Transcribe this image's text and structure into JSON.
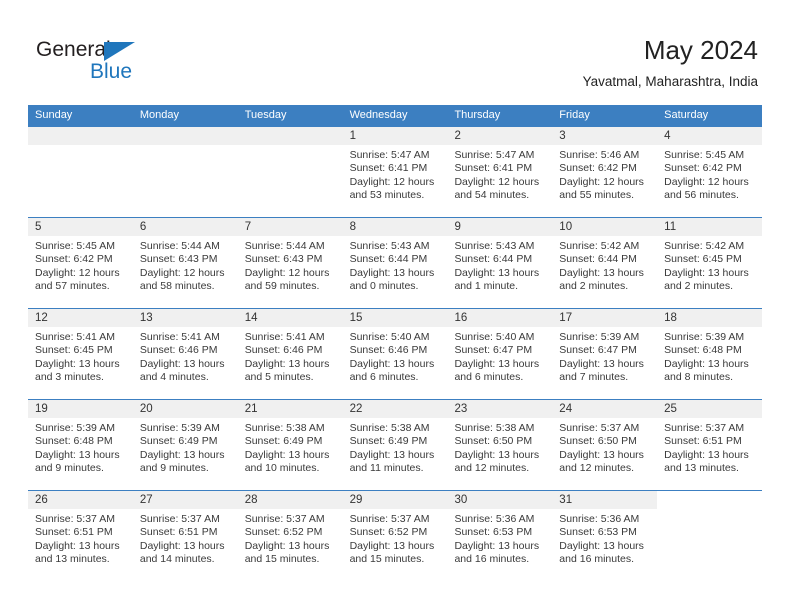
{
  "brand": {
    "name_part1": "General",
    "name_part2": "Blue",
    "flag_icon": "triangle-flag-icon",
    "color_blue": "#1f76bc",
    "color_dark": "#231f20"
  },
  "header": {
    "title": "May 2024",
    "subtitle": "Yavatmal, Maharashtra, India"
  },
  "calendar": {
    "header_color": "#3c7fc1",
    "date_strip_color": "#f0f0f0",
    "weekdays": [
      "Sunday",
      "Monday",
      "Tuesday",
      "Wednesday",
      "Thursday",
      "Friday",
      "Saturday"
    ],
    "weeks": [
      {
        "days": [
          {
            "date": "",
            "sunrise": "",
            "sunset": "",
            "daylight_line1": "",
            "daylight_line2": ""
          },
          {
            "date": "",
            "sunrise": "",
            "sunset": "",
            "daylight_line1": "",
            "daylight_line2": ""
          },
          {
            "date": "",
            "sunrise": "",
            "sunset": "",
            "daylight_line1": "",
            "daylight_line2": ""
          },
          {
            "date": "1",
            "sunrise": "Sunrise: 5:47 AM",
            "sunset": "Sunset: 6:41 PM",
            "daylight_line1": "Daylight: 12 hours",
            "daylight_line2": "and 53 minutes."
          },
          {
            "date": "2",
            "sunrise": "Sunrise: 5:47 AM",
            "sunset": "Sunset: 6:41 PM",
            "daylight_line1": "Daylight: 12 hours",
            "daylight_line2": "and 54 minutes."
          },
          {
            "date": "3",
            "sunrise": "Sunrise: 5:46 AM",
            "sunset": "Sunset: 6:42 PM",
            "daylight_line1": "Daylight: 12 hours",
            "daylight_line2": "and 55 minutes."
          },
          {
            "date": "4",
            "sunrise": "Sunrise: 5:45 AM",
            "sunset": "Sunset: 6:42 PM",
            "daylight_line1": "Daylight: 12 hours",
            "daylight_line2": "and 56 minutes."
          }
        ]
      },
      {
        "days": [
          {
            "date": "5",
            "sunrise": "Sunrise: 5:45 AM",
            "sunset": "Sunset: 6:42 PM",
            "daylight_line1": "Daylight: 12 hours",
            "daylight_line2": "and 57 minutes."
          },
          {
            "date": "6",
            "sunrise": "Sunrise: 5:44 AM",
            "sunset": "Sunset: 6:43 PM",
            "daylight_line1": "Daylight: 12 hours",
            "daylight_line2": "and 58 minutes."
          },
          {
            "date": "7",
            "sunrise": "Sunrise: 5:44 AM",
            "sunset": "Sunset: 6:43 PM",
            "daylight_line1": "Daylight: 12 hours",
            "daylight_line2": "and 59 minutes."
          },
          {
            "date": "8",
            "sunrise": "Sunrise: 5:43 AM",
            "sunset": "Sunset: 6:44 PM",
            "daylight_line1": "Daylight: 13 hours",
            "daylight_line2": "and 0 minutes."
          },
          {
            "date": "9",
            "sunrise": "Sunrise: 5:43 AM",
            "sunset": "Sunset: 6:44 PM",
            "daylight_line1": "Daylight: 13 hours",
            "daylight_line2": "and 1 minute."
          },
          {
            "date": "10",
            "sunrise": "Sunrise: 5:42 AM",
            "sunset": "Sunset: 6:44 PM",
            "daylight_line1": "Daylight: 13 hours",
            "daylight_line2": "and 2 minutes."
          },
          {
            "date": "11",
            "sunrise": "Sunrise: 5:42 AM",
            "sunset": "Sunset: 6:45 PM",
            "daylight_line1": "Daylight: 13 hours",
            "daylight_line2": "and 2 minutes."
          }
        ]
      },
      {
        "days": [
          {
            "date": "12",
            "sunrise": "Sunrise: 5:41 AM",
            "sunset": "Sunset: 6:45 PM",
            "daylight_line1": "Daylight: 13 hours",
            "daylight_line2": "and 3 minutes."
          },
          {
            "date": "13",
            "sunrise": "Sunrise: 5:41 AM",
            "sunset": "Sunset: 6:46 PM",
            "daylight_line1": "Daylight: 13 hours",
            "daylight_line2": "and 4 minutes."
          },
          {
            "date": "14",
            "sunrise": "Sunrise: 5:41 AM",
            "sunset": "Sunset: 6:46 PM",
            "daylight_line1": "Daylight: 13 hours",
            "daylight_line2": "and 5 minutes."
          },
          {
            "date": "15",
            "sunrise": "Sunrise: 5:40 AM",
            "sunset": "Sunset: 6:46 PM",
            "daylight_line1": "Daylight: 13 hours",
            "daylight_line2": "and 6 minutes."
          },
          {
            "date": "16",
            "sunrise": "Sunrise: 5:40 AM",
            "sunset": "Sunset: 6:47 PM",
            "daylight_line1": "Daylight: 13 hours",
            "daylight_line2": "and 6 minutes."
          },
          {
            "date": "17",
            "sunrise": "Sunrise: 5:39 AM",
            "sunset": "Sunset: 6:47 PM",
            "daylight_line1": "Daylight: 13 hours",
            "daylight_line2": "and 7 minutes."
          },
          {
            "date": "18",
            "sunrise": "Sunrise: 5:39 AM",
            "sunset": "Sunset: 6:48 PM",
            "daylight_line1": "Daylight: 13 hours",
            "daylight_line2": "and 8 minutes."
          }
        ]
      },
      {
        "days": [
          {
            "date": "19",
            "sunrise": "Sunrise: 5:39 AM",
            "sunset": "Sunset: 6:48 PM",
            "daylight_line1": "Daylight: 13 hours",
            "daylight_line2": "and 9 minutes."
          },
          {
            "date": "20",
            "sunrise": "Sunrise: 5:39 AM",
            "sunset": "Sunset: 6:49 PM",
            "daylight_line1": "Daylight: 13 hours",
            "daylight_line2": "and 9 minutes."
          },
          {
            "date": "21",
            "sunrise": "Sunrise: 5:38 AM",
            "sunset": "Sunset: 6:49 PM",
            "daylight_line1": "Daylight: 13 hours",
            "daylight_line2": "and 10 minutes."
          },
          {
            "date": "22",
            "sunrise": "Sunrise: 5:38 AM",
            "sunset": "Sunset: 6:49 PM",
            "daylight_line1": "Daylight: 13 hours",
            "daylight_line2": "and 11 minutes."
          },
          {
            "date": "23",
            "sunrise": "Sunrise: 5:38 AM",
            "sunset": "Sunset: 6:50 PM",
            "daylight_line1": "Daylight: 13 hours",
            "daylight_line2": "and 12 minutes."
          },
          {
            "date": "24",
            "sunrise": "Sunrise: 5:37 AM",
            "sunset": "Sunset: 6:50 PM",
            "daylight_line1": "Daylight: 13 hours",
            "daylight_line2": "and 12 minutes."
          },
          {
            "date": "25",
            "sunrise": "Sunrise: 5:37 AM",
            "sunset": "Sunset: 6:51 PM",
            "daylight_line1": "Daylight: 13 hours",
            "daylight_line2": "and 13 minutes."
          }
        ]
      },
      {
        "days": [
          {
            "date": "26",
            "sunrise": "Sunrise: 5:37 AM",
            "sunset": "Sunset: 6:51 PM",
            "daylight_line1": "Daylight: 13 hours",
            "daylight_line2": "and 13 minutes."
          },
          {
            "date": "27",
            "sunrise": "Sunrise: 5:37 AM",
            "sunset": "Sunset: 6:51 PM",
            "daylight_line1": "Daylight: 13 hours",
            "daylight_line2": "and 14 minutes."
          },
          {
            "date": "28",
            "sunrise": "Sunrise: 5:37 AM",
            "sunset": "Sunset: 6:52 PM",
            "daylight_line1": "Daylight: 13 hours",
            "daylight_line2": "and 15 minutes."
          },
          {
            "date": "29",
            "sunrise": "Sunrise: 5:37 AM",
            "sunset": "Sunset: 6:52 PM",
            "daylight_line1": "Daylight: 13 hours",
            "daylight_line2": "and 15 minutes."
          },
          {
            "date": "30",
            "sunrise": "Sunrise: 5:36 AM",
            "sunset": "Sunset: 6:53 PM",
            "daylight_line1": "Daylight: 13 hours",
            "daylight_line2": "and 16 minutes."
          },
          {
            "date": "31",
            "sunrise": "Sunrise: 5:36 AM",
            "sunset": "Sunset: 6:53 PM",
            "daylight_line1": "Daylight: 13 hours",
            "daylight_line2": "and 16 minutes."
          },
          {
            "date": "",
            "sunrise": "",
            "sunset": "",
            "daylight_line1": "",
            "daylight_line2": ""
          }
        ]
      }
    ]
  }
}
